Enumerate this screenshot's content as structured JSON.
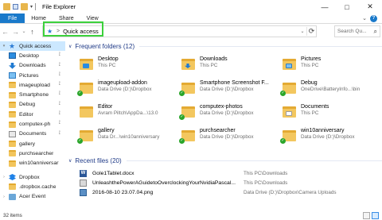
{
  "window": {
    "title": "File Explorer",
    "controls": {
      "minimize": "—",
      "maximize": "□",
      "close": "✕"
    }
  },
  "ribbon": {
    "tabs": [
      "File",
      "Home",
      "Share",
      "View"
    ],
    "expand_glyph": "⌄",
    "help_glyph": "?"
  },
  "address": {
    "back_glyph": "←",
    "forward_glyph": "→",
    "recent_glyph": "⌄",
    "up_glyph": "↑",
    "separator": ">",
    "location": "Quick access",
    "dropdown_glyph": "⌄",
    "refresh_glyph": "⟳",
    "search_placeholder": "Search Qu...",
    "search_glyph": "⌕"
  },
  "sidebar": {
    "quick_access": {
      "label": "Quick access",
      "icon": "star-icon"
    },
    "pinned": [
      {
        "label": "Desktop",
        "icon": "desktop-icon",
        "pinned": true
      },
      {
        "label": "Downloads",
        "icon": "download-icon",
        "pinned": true
      },
      {
        "label": "Pictures",
        "icon": "pictures-icon",
        "pinned": true
      },
      {
        "label": "imageupload",
        "icon": "folder-icon",
        "pinned": true
      },
      {
        "label": "Smartphone",
        "icon": "folder-icon",
        "pinned": true
      },
      {
        "label": "Debug",
        "icon": "folder-icon",
        "pinned": true
      },
      {
        "label": "Editor",
        "icon": "folder-icon",
        "pinned": true
      },
      {
        "label": "computex-ph",
        "icon": "folder-icon",
        "pinned": true
      },
      {
        "label": "Documents",
        "icon": "documents-icon",
        "pinned": true
      },
      {
        "label": "gallery",
        "icon": "folder-icon",
        "pinned": false
      },
      {
        "label": "purchsearcher",
        "icon": "folder-icon",
        "pinned": false
      },
      {
        "label": "win10anniversar",
        "icon": "folder-icon",
        "pinned": false
      }
    ],
    "dropbox": {
      "label": "Dropbox",
      "icon": "dropbox-icon"
    },
    "dropbox_cache": {
      "label": ".dropbox.cache",
      "icon": "folder-icon"
    },
    "acer": {
      "label": "Acer Event",
      "icon": "acer-icon"
    },
    "pin_glyph": "📌"
  },
  "frequent": {
    "header": "Frequent folders (12)",
    "folders": [
      {
        "name": "Desktop",
        "location": "This PC",
        "inner": "desk",
        "synced": false,
        "icon": "desktop-folder-icon"
      },
      {
        "name": "Downloads",
        "location": "This PC",
        "inner": "dl",
        "synced": false,
        "icon": "downloads-folder-icon"
      },
      {
        "name": "Pictures",
        "location": "This PC",
        "inner": "pic",
        "synced": false,
        "icon": "pictures-folder-icon"
      },
      {
        "name": "imageupload-addon",
        "location": "Data Drive (D:)\\Dropbox",
        "inner": "",
        "synced": true,
        "icon": "folder-icon"
      },
      {
        "name": "Smartphone Screenshot F...",
        "location": "Data Drive (D:)\\Dropbox",
        "inner": "",
        "synced": true,
        "icon": "folder-icon"
      },
      {
        "name": "Debug",
        "location": "OneDrive\\BatteryInfo...\\bin",
        "inner": "",
        "synced": true,
        "icon": "folder-icon"
      },
      {
        "name": "Editor",
        "location": "Avram Piltch\\AppDa...\\13.0",
        "inner": "",
        "synced": false,
        "icon": "folder-icon"
      },
      {
        "name": "computex-photos",
        "location": "Data Drive (D:)\\Dropbox",
        "inner": "",
        "synced": true,
        "icon": "folder-icon"
      },
      {
        "name": "Documents",
        "location": "This PC",
        "inner": "doc",
        "synced": false,
        "icon": "documents-folder-icon"
      },
      {
        "name": "gallery",
        "location": "Data Dr...\\win10anniversary",
        "inner": "",
        "synced": true,
        "icon": "folder-icon"
      },
      {
        "name": "purchsearcher",
        "location": "Data Drive (D:)\\Dropbox",
        "inner": "",
        "synced": true,
        "icon": "folder-icon"
      },
      {
        "name": "win10anniversary",
        "location": "Data Drive (D:)\\Dropbox",
        "inner": "",
        "synced": true,
        "icon": "folder-icon"
      }
    ],
    "check_glyph": "✓"
  },
  "recent": {
    "header": "Recent files (20)",
    "files": [
      {
        "name": "Gole1Tablet.docx",
        "path": "This PC\\Downloads",
        "type": "word",
        "icon": "word-doc-icon"
      },
      {
        "name": "UnleashthePowerAGuidetoOverclockingYourNvidiaPascal...",
        "path": "This PC\\Downloads",
        "type": "pdf",
        "icon": "document-icon"
      },
      {
        "name": "2016-08-10 23.07.04.png",
        "path": "Data Drive (D:)\\Dropbox\\Camera Uploads",
        "type": "img",
        "icon": "image-file-icon"
      }
    ]
  },
  "status": {
    "items": "32 items"
  },
  "colors": {
    "accent": "#1979ca",
    "selection": "#cce8ff",
    "highlight_box": "#3cd13c",
    "folder": "#f3c75f"
  }
}
